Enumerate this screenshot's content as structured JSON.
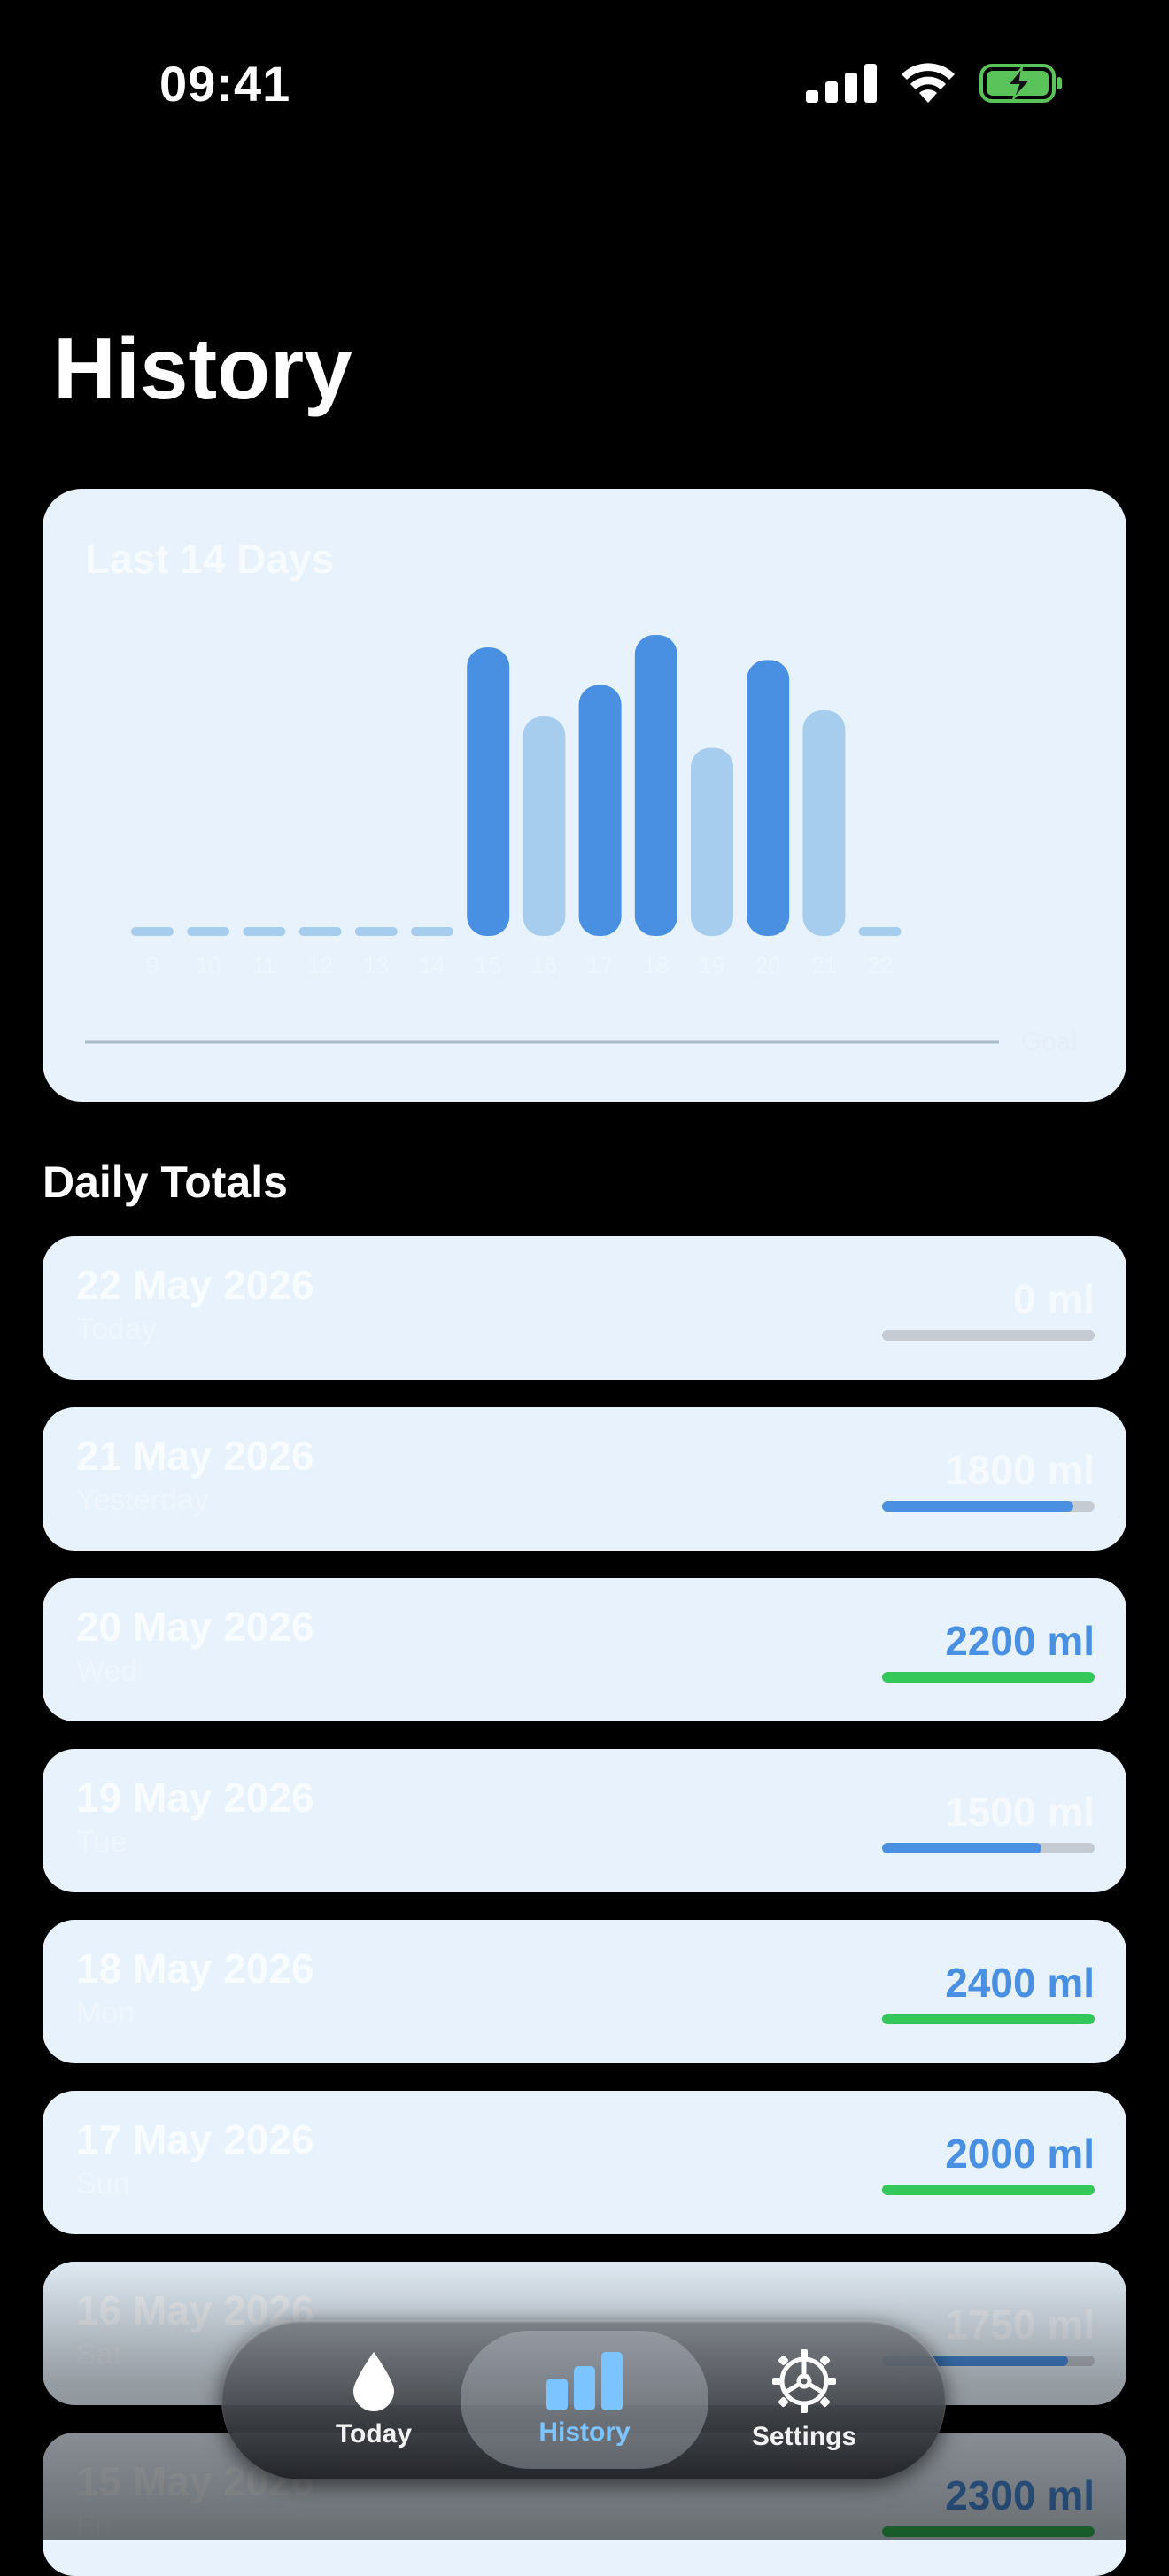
{
  "status_bar": {
    "time": "09:41"
  },
  "page_title": "History",
  "chart_card": {
    "title": "Last 14 Days",
    "goal_label": "Goal"
  },
  "chart_data": {
    "type": "bar",
    "title": "Last 14 Days",
    "categories": [
      "9",
      "10",
      "11",
      "12",
      "13",
      "14",
      "15",
      "16",
      "17",
      "18",
      "19",
      "20",
      "21",
      "22"
    ],
    "values": [
      0,
      0,
      0,
      0,
      0,
      0,
      2300,
      1750,
      2000,
      2400,
      1500,
      2200,
      1800,
      0
    ],
    "goal": 2000,
    "ylim": [
      0,
      2500
    ],
    "colors": {
      "met_goal": "#4a90e2",
      "below_goal": "#a6ccee"
    },
    "grid": false
  },
  "section_title": "Daily Totals",
  "days": [
    {
      "date": "22 May 2026",
      "sub": "Today",
      "amount": "0 ml",
      "progress": 0,
      "color": "#c5cbd3",
      "strong": false
    },
    {
      "date": "21 May 2026",
      "sub": "Yesterday",
      "amount": "1800 ml",
      "progress": 0.9,
      "color": "#4a90e2",
      "strong": false
    },
    {
      "date": "20 May 2026",
      "sub": "Wed",
      "amount": "2200 ml",
      "progress": 1.0,
      "color": "#34c759",
      "strong": true
    },
    {
      "date": "19 May 2026",
      "sub": "Tue",
      "amount": "1500 ml",
      "progress": 0.75,
      "color": "#4a90e2",
      "strong": false
    },
    {
      "date": "18 May 2026",
      "sub": "Mon",
      "amount": "2400 ml",
      "progress": 1.0,
      "color": "#34c759",
      "strong": true
    },
    {
      "date": "17 May 2026",
      "sub": "Sun",
      "amount": "2000 ml",
      "progress": 1.0,
      "color": "#34c759",
      "strong": true
    },
    {
      "date": "16 May 2026",
      "sub": "Sat",
      "amount": "1750 ml",
      "progress": 0.875,
      "color": "#4a90e2",
      "strong": false
    },
    {
      "date": "15 May 2026",
      "sub": "Fri",
      "amount": "2300 ml",
      "progress": 1.0,
      "color": "#34c759",
      "strong": true
    }
  ],
  "tab_bar": {
    "items": [
      {
        "label": "Today",
        "icon": "drop-icon"
      },
      {
        "label": "History",
        "icon": "bar-chart-icon"
      },
      {
        "label": "Settings",
        "icon": "gear-icon"
      }
    ],
    "active": "History"
  }
}
